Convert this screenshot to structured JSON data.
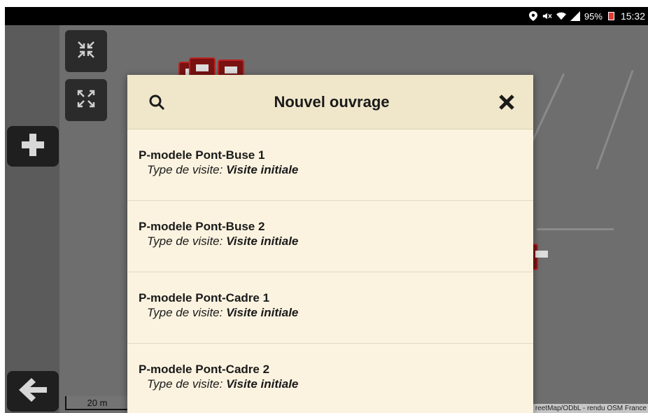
{
  "status_bar": {
    "battery": "95%",
    "time": "15:32"
  },
  "map": {
    "scale_label": "20 m",
    "attribution": "reetMap/ODbL - rendu OSM France",
    "buttons": [
      "collapse-icon",
      "expand-icon",
      "plus-icon",
      "arrow-left-icon"
    ]
  },
  "dialog": {
    "title": "Nouvel ouvrage",
    "items": [
      {
        "name": "P-modele Pont-Buse 1",
        "type_label": "Type de visite:",
        "type_value": "Visite initiale"
      },
      {
        "name": "P-modele Pont-Buse 2",
        "type_label": "Type de visite:",
        "type_value": "Visite initiale"
      },
      {
        "name": "P-modele Pont-Cadre 1",
        "type_label": "Type de visite:",
        "type_value": "Visite initiale"
      },
      {
        "name": "P-modele Pont-Cadre 2",
        "type_label": "Type de visite:",
        "type_value": "Visite initiale"
      }
    ]
  },
  "colors": {
    "dialog_bg": "#fbf3e0",
    "dialog_header_bg": "#f0e7cb",
    "map_bg": "#6e6e6e",
    "marker": "#7a1212"
  }
}
